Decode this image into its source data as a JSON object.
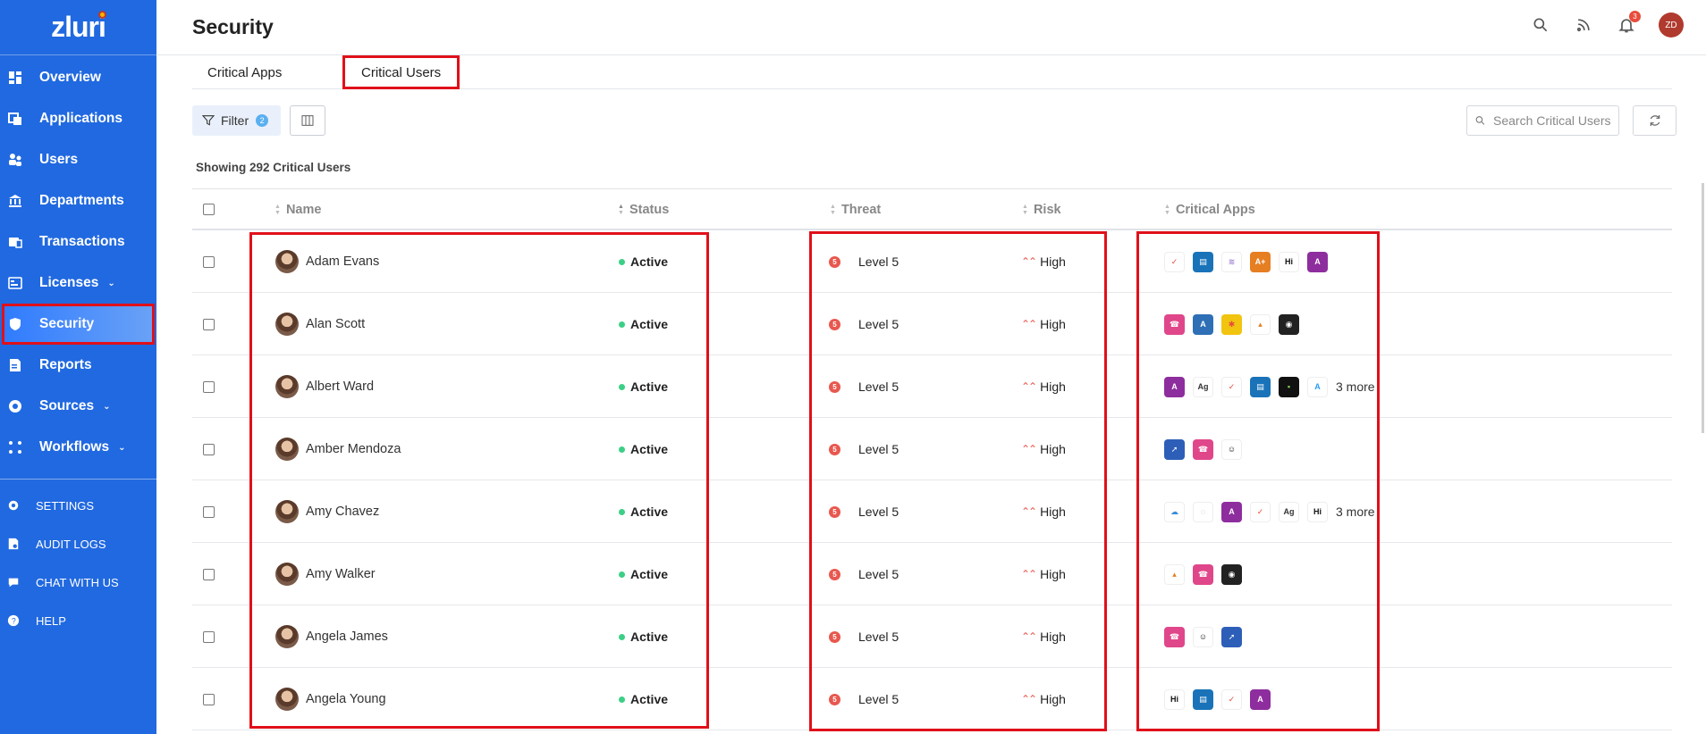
{
  "app": {
    "logo": "zluri"
  },
  "sidebar": {
    "items": [
      {
        "label": "Overview",
        "icon": "dashboard-icon"
      },
      {
        "label": "Applications",
        "icon": "applications-icon"
      },
      {
        "label": "Users",
        "icon": "users-icon"
      },
      {
        "label": "Departments",
        "icon": "departments-icon"
      },
      {
        "label": "Transactions",
        "icon": "transactions-icon"
      },
      {
        "label": "Licenses",
        "icon": "licenses-icon",
        "expandable": true
      },
      {
        "label": "Security",
        "icon": "shield-icon",
        "active": true
      },
      {
        "label": "Reports",
        "icon": "reports-icon"
      },
      {
        "label": "Sources",
        "icon": "sources-icon",
        "expandable": true
      },
      {
        "label": "Workflows",
        "icon": "workflows-icon",
        "expandable": true
      }
    ],
    "secondary": [
      {
        "label": "SETTINGS",
        "icon": "gear-icon"
      },
      {
        "label": "AUDIT LOGS",
        "icon": "audit-log-icon"
      },
      {
        "label": "CHAT WITH US",
        "icon": "chat-icon"
      },
      {
        "label": "HELP",
        "icon": "help-icon"
      }
    ]
  },
  "header": {
    "title": "Security",
    "notification_count": "3",
    "user_initials": "ZD"
  },
  "tabs": [
    {
      "label": "Critical Apps",
      "active": false
    },
    {
      "label": "Critical Users",
      "active": true
    }
  ],
  "toolbar": {
    "filter_label": "Filter",
    "filter_count": "2",
    "search_placeholder": "Search Critical Users"
  },
  "summary": "Showing 292 Critical Users",
  "table": {
    "columns": [
      "Name",
      "Status",
      "Threat",
      "Risk",
      "Critical Apps"
    ],
    "rows": [
      {
        "name": "Adam Evans",
        "status": "Active",
        "threat": "Level 5",
        "risk": "High",
        "apps": [
          [
            "#fff",
            "#e74c3c",
            "✓"
          ],
          [
            "#1a73b8",
            "#fff",
            "▤"
          ],
          [
            "#fff",
            "#9b7fd4",
            "≋"
          ],
          [
            "#e67e22",
            "#fff",
            "A+"
          ],
          [
            "#fff",
            "#111",
            "Hi"
          ],
          [
            "#8e2d9e",
            "#fff",
            "A"
          ]
        ],
        "more": ""
      },
      {
        "name": "Alan Scott",
        "status": "Active",
        "threat": "Level 5",
        "risk": "High",
        "apps": [
          [
            "#e0468a",
            "#fff",
            "☎"
          ],
          [
            "#2e6fb5",
            "#fff",
            "A"
          ],
          [
            "#f1c40f",
            "#e74c3c",
            "✱"
          ],
          [
            "#fff",
            "#e67e22",
            "▴"
          ],
          [
            "#222",
            "#fff",
            "◉"
          ]
        ],
        "more": ""
      },
      {
        "name": "Albert Ward",
        "status": "Active",
        "threat": "Level 5",
        "risk": "High",
        "apps": [
          [
            "#8e2d9e",
            "#fff",
            "A"
          ],
          [
            "#fff",
            "#333",
            "Ag"
          ],
          [
            "#fff",
            "#e74c3c",
            "✓"
          ],
          [
            "#1a73b8",
            "#fff",
            "▤"
          ],
          [
            "#111",
            "#7ed957",
            "▪"
          ],
          [
            "#fff",
            "#2a9df4",
            "A"
          ]
        ],
        "more": "3 more"
      },
      {
        "name": "Amber Mendoza",
        "status": "Active",
        "threat": "Level 5",
        "risk": "High",
        "apps": [
          [
            "#2d5fb8",
            "#fff",
            "➚"
          ],
          [
            "#e0468a",
            "#fff",
            "☎"
          ],
          [
            "#fff",
            "#111",
            "☺"
          ]
        ],
        "more": ""
      },
      {
        "name": "Amy Chavez",
        "status": "Active",
        "threat": "Level 5",
        "risk": "High",
        "apps": [
          [
            "#fff",
            "#3a8ed9",
            "☁"
          ],
          [
            "#fff",
            "#999",
            "◌"
          ],
          [
            "#8e2d9e",
            "#fff",
            "A"
          ],
          [
            "#fff",
            "#e74c3c",
            "✓"
          ],
          [
            "#fff",
            "#333",
            "Ag"
          ],
          [
            "#fff",
            "#111",
            "Hi"
          ]
        ],
        "more": "3 more"
      },
      {
        "name": "Amy Walker",
        "status": "Active",
        "threat": "Level 5",
        "risk": "High",
        "apps": [
          [
            "#fff",
            "#e67e22",
            "▴"
          ],
          [
            "#e0468a",
            "#fff",
            "☎"
          ],
          [
            "#222",
            "#fff",
            "◉"
          ]
        ],
        "more": ""
      },
      {
        "name": "Angela James",
        "status": "Active",
        "threat": "Level 5",
        "risk": "High",
        "apps": [
          [
            "#e0468a",
            "#fff",
            "☎"
          ],
          [
            "#fff",
            "#111",
            "☺"
          ],
          [
            "#2d5fb8",
            "#fff",
            "➚"
          ]
        ],
        "more": ""
      },
      {
        "name": "Angela Young",
        "status": "Active",
        "threat": "Level 5",
        "risk": "High",
        "apps": [
          [
            "#fff",
            "#111",
            "Hi"
          ],
          [
            "#1a73b8",
            "#fff",
            "▤"
          ],
          [
            "#fff",
            "#e74c3c",
            "✓"
          ],
          [
            "#8e2d9e",
            "#fff",
            "A"
          ]
        ],
        "more": ""
      }
    ]
  },
  "colors": {
    "sidebar": "#2169e0",
    "status_active": "#3ccf86",
    "threat": "#e8584e",
    "highlight": "#e0101a"
  }
}
